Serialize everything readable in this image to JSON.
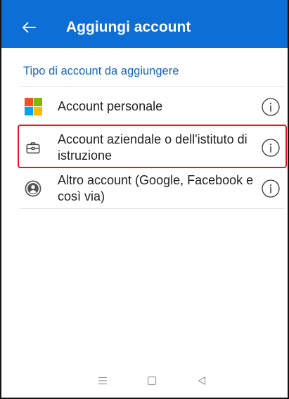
{
  "header": {
    "back_icon": "arrow-left-icon",
    "title": "Aggiungi account"
  },
  "section_label": "Tipo di account da aggiungere",
  "accounts": [
    {
      "icon": "microsoft-logo-icon",
      "label": "Account personale",
      "info_icon": "info-icon",
      "highlighted": false
    },
    {
      "icon": "briefcase-icon",
      "label": "Account aziendale o dell'istituto di istruzione",
      "info_icon": "info-icon",
      "highlighted": true
    },
    {
      "icon": "person-circle-icon",
      "label": "Altro account (Google, Facebook e così via)",
      "info_icon": "info-icon",
      "highlighted": false
    }
  ],
  "nav_bar": {
    "icons": [
      "menu-icon",
      "home-icon",
      "back-icon"
    ]
  },
  "colors": {
    "header_background": "#0d6fd6",
    "header_text": "#ffffff",
    "section_label": "#1564c4",
    "highlight": "#e8151c",
    "microsoft_logo": [
      "#f25022",
      "#7fba00",
      "#00a4ef",
      "#ffb900"
    ]
  }
}
